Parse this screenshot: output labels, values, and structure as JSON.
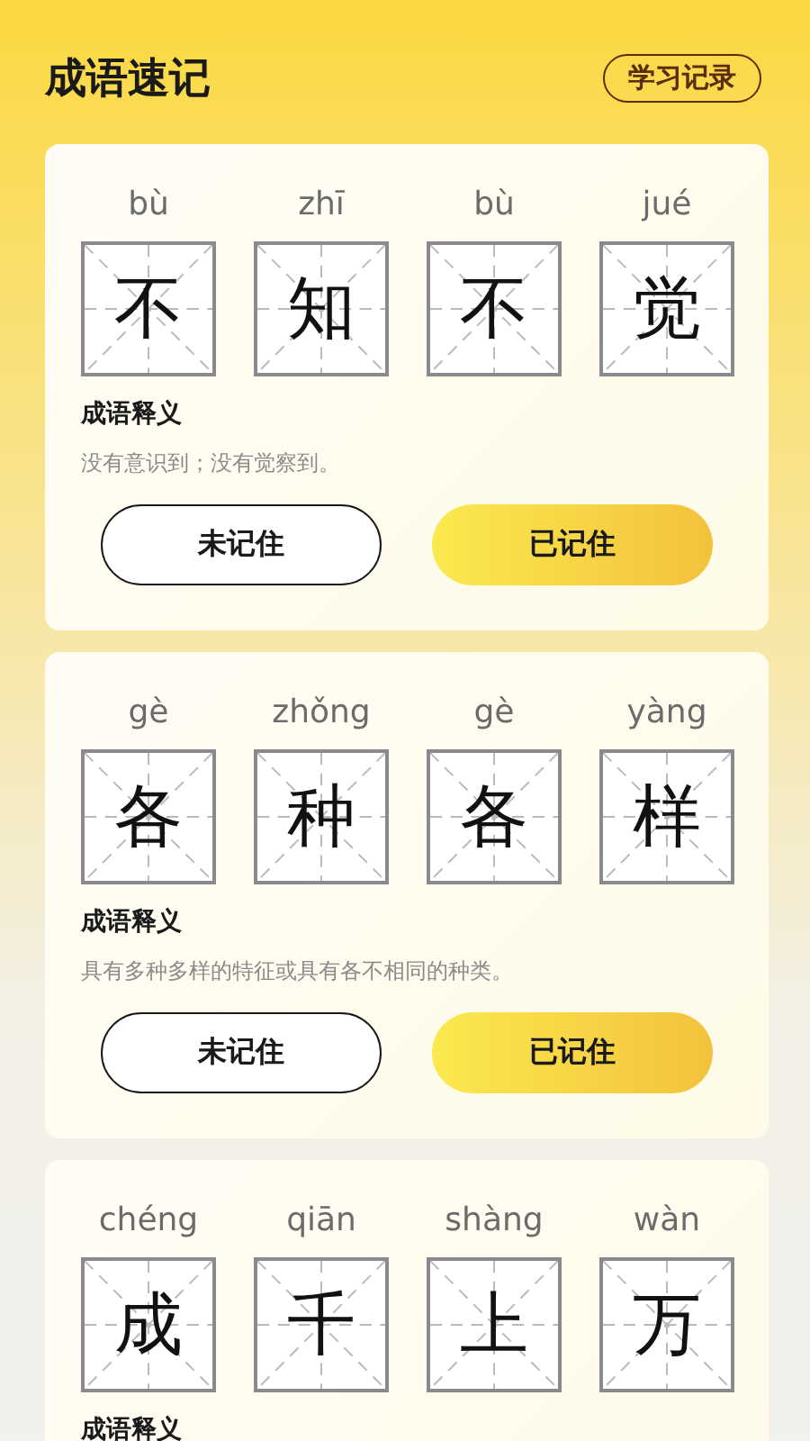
{
  "header": {
    "title": "成语速记",
    "record_button": "学习记录"
  },
  "cards": [
    {
      "characters": [
        {
          "pinyin": "bù",
          "char": "不"
        },
        {
          "pinyin": "zhī",
          "char": "知"
        },
        {
          "pinyin": "bù",
          "char": "不"
        },
        {
          "pinyin": "jué",
          "char": "觉"
        }
      ],
      "meaning_label": "成语释义",
      "meaning": "没有意识到；没有觉察到。",
      "buttons": [
        {
          "label": "未记住",
          "kind": "outline"
        },
        {
          "label": "已记住",
          "kind": "filled"
        }
      ]
    },
    {
      "characters": [
        {
          "pinyin": "gè",
          "char": "各"
        },
        {
          "pinyin": "zhǒng",
          "char": "种"
        },
        {
          "pinyin": "gè",
          "char": "各"
        },
        {
          "pinyin": "yàng",
          "char": "样"
        }
      ],
      "meaning_label": "成语释义",
      "meaning": "具有多种多样的特征或具有各不相同的种类。",
      "buttons": [
        {
          "label": "未记住",
          "kind": "outline"
        },
        {
          "label": "已记住",
          "kind": "filled"
        }
      ]
    },
    {
      "characters": [
        {
          "pinyin": "chéng",
          "char": "成"
        },
        {
          "pinyin": "qiān",
          "char": "千"
        },
        {
          "pinyin": "shàng",
          "char": "上"
        },
        {
          "pinyin": "wàn",
          "char": "万"
        }
      ],
      "meaning_label": "成语释义"
    }
  ]
}
